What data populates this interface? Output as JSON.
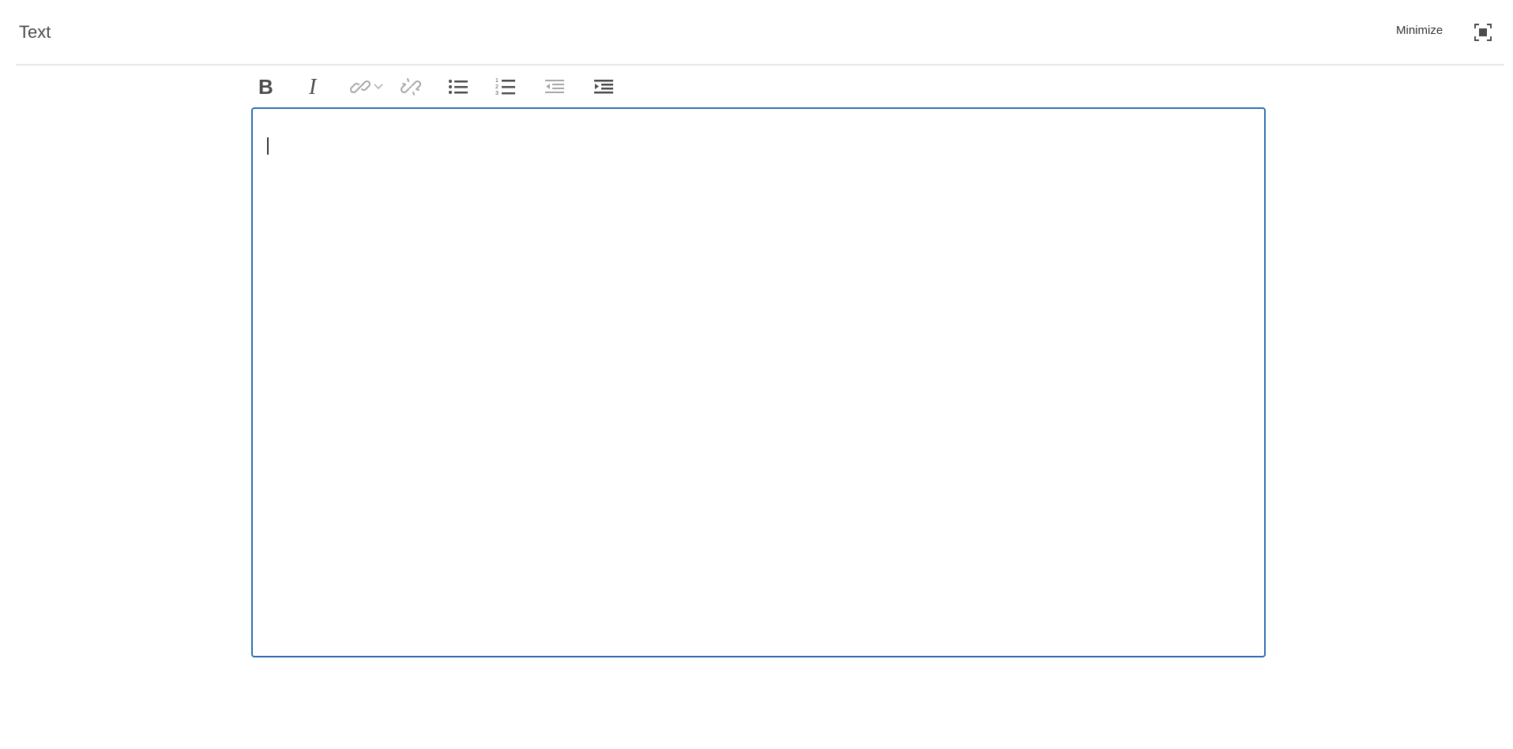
{
  "header": {
    "title": "Text",
    "minimize_label": "Minimize",
    "fullscreen_icon": "fullscreen-icon"
  },
  "toolbar": {
    "items": [
      {
        "name": "bold",
        "icon": "bold-icon",
        "enabled": true
      },
      {
        "name": "italic",
        "icon": "italic-icon",
        "enabled": true
      },
      {
        "name": "link",
        "icon": "link-icon",
        "enabled": false,
        "has_dropdown": true
      },
      {
        "name": "unlink",
        "icon": "unlink-icon",
        "enabled": false
      },
      {
        "name": "bulleted-list",
        "icon": "bulleted-list-icon",
        "enabled": true
      },
      {
        "name": "numbered-list",
        "icon": "numbered-list-icon",
        "enabled": true
      },
      {
        "name": "outdent",
        "icon": "outdent-icon",
        "enabled": false
      },
      {
        "name": "indent",
        "icon": "indent-icon",
        "enabled": true
      }
    ]
  },
  "editor": {
    "value": "",
    "focused": true
  },
  "colors": {
    "editor_border": "#2d6bb3",
    "header_divider": "#e6e6e6",
    "icon_enabled": "#4b4b4b",
    "icon_disabled": "#a8a8a8"
  }
}
